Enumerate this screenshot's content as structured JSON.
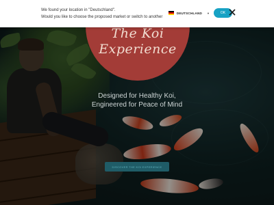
{
  "banner": {
    "line1": "We found your location in \"Deutschland\".",
    "line2": "Would you like to choose the proposed market or switch to another one?",
    "country_selected": "DEUTSCHLAND",
    "ok_label": "OK",
    "flag_colors": [
      "#000000",
      "#dd0000",
      "#ffce00"
    ],
    "accent": "#17a2c4"
  },
  "hero": {
    "logo_line1": "The Koi",
    "logo_line2": "Experience",
    "tagline_line1": "Designed for Healthy Koi,",
    "tagline_line2": "Engineered for Peace of Mind",
    "cta_label": "Discover the Koi Experience",
    "badge_color": "#a33c37"
  }
}
